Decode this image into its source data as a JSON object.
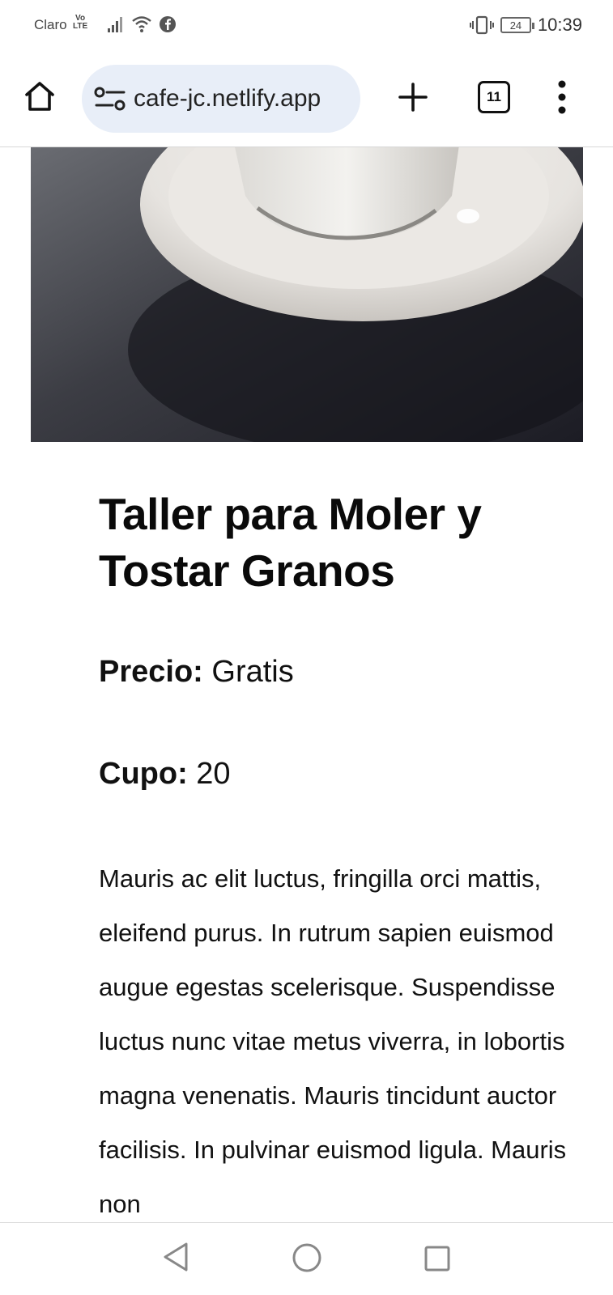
{
  "status_bar": {
    "carrier": "Claro",
    "volte_top": "Vo",
    "volte_bottom": "LTE",
    "battery": "24",
    "time": "10:39"
  },
  "browser": {
    "url": "cafe-jc.netlify.app",
    "tab_count": "11"
  },
  "article": {
    "title": "Taller para Moler y Tostar Granos",
    "price_label": "Precio:",
    "price_value": "Gratis",
    "capacity_label": "Cupo:",
    "capacity_value": "20",
    "description": "Mauris ac elit luctus, fringilla orci mattis, eleifend purus. In rutrum sapien euismod augue egestas scelerisque. Suspendisse luctus nunc vitae metus viverra, in lobortis magna venenatis. Mauris tincidunt auctor facilisis. In pulvinar euismod ligula. Mauris non"
  },
  "icons": {
    "home": "home-icon",
    "site_settings": "site-settings-icon",
    "new_tab": "plus-icon",
    "tabs": "tab-switcher-icon",
    "menu": "more-vert-icon",
    "nav_back": "triangle-back-icon",
    "nav_home": "circle-home-icon",
    "nav_recent": "square-recents-icon"
  }
}
